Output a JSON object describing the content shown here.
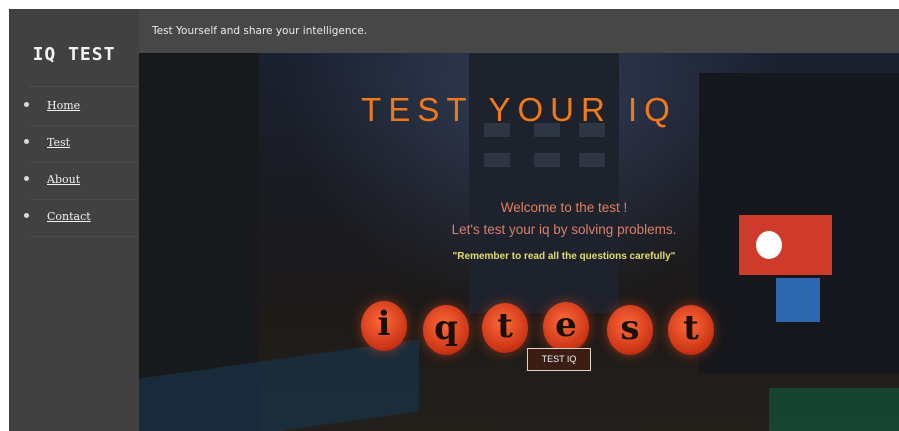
{
  "sidebar": {
    "brand": "IQ TEST",
    "items": [
      {
        "label": "Home"
      },
      {
        "label": "Test"
      },
      {
        "label": "About"
      },
      {
        "label": "Contact"
      }
    ]
  },
  "topbar": {
    "tagline": "Test Yourself and share your intelligence."
  },
  "hero": {
    "title": "TEST YOUR IQ",
    "welcome": "Welcome to the test !",
    "subtitle": "Let's test your iq by solving problems.",
    "reminder": "\"Remember to read all the questions carefully\"",
    "lantern_letters": [
      "i",
      "q",
      "t",
      "e",
      "s",
      "t"
    ],
    "button_label": "TEST IQ"
  },
  "colors": {
    "title_orange": "#f07a1a",
    "welcome_text": "#e2805b",
    "reminder_yellow": "#e3dd72",
    "sidebar_bg": "#414141",
    "topbar_bg": "#474747",
    "button_bg": "#3c1d13"
  }
}
